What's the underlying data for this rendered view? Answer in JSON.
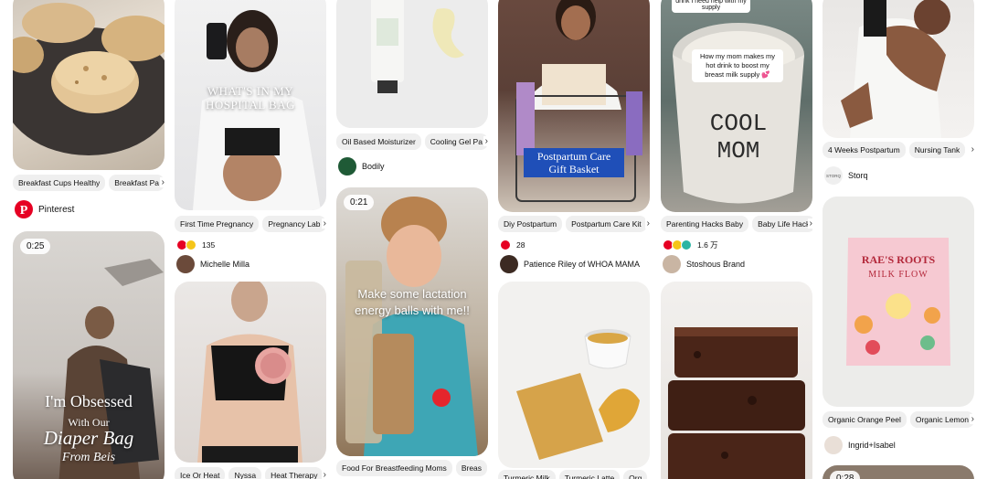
{
  "colors": {
    "pinterest_red": "#e60023",
    "chip_bg": "#efefef"
  },
  "col1": {
    "tags": [
      "Breakfast Cups Healthy",
      "Breakfast Pa"
    ],
    "source_name": "Pinterest",
    "video2_duration": "0:25",
    "video2_line1": "I'm Obsessed",
    "video2_line2": "With Our",
    "video2_line3": "Diaper Bag",
    "video2_line4": "From Beis"
  },
  "col2": {
    "pin1_text": "WHAT'S IN MY HOSPITAL BAG",
    "tags": [
      "First Time Pregnancy",
      "Pregnancy Lab"
    ],
    "reaction_count": "135",
    "author": "Michelle Milla",
    "tags2": [
      "Ice Or Heat",
      "Nyssa",
      "Heat Therapy"
    ]
  },
  "col3": {
    "tags": [
      "Oil Based Moisturizer",
      "Cooling Gel Pa"
    ],
    "author": "Bodily",
    "video_duration": "0:21",
    "video_caption": "Make some lactation energy balls with me!!",
    "tags2": [
      "Food For Breastfeeding Moms",
      "Breas"
    ]
  },
  "col4": {
    "pin1_text": "Postpartum Care Gift Basket",
    "tags": [
      "Diy Postpartum",
      "Postpartum Care Kit"
    ],
    "reaction_count": "28",
    "author": "Patience Riley of WHOA MAMA",
    "tags2": [
      "Turmeric Milk",
      "Turmeric Latte",
      "Org"
    ]
  },
  "col5": {
    "pin1_note_top": "drink I need help with my supply",
    "pin1_note": "How my mom makes my hot drink to boost my breast milk supply 💕",
    "pin1_mug_text": "COOL MOM",
    "tags": [
      "Parenting Hacks Baby",
      "Baby Life Hack"
    ],
    "reaction_count": "1.6 万",
    "author": "Stoshous Brand"
  },
  "col6": {
    "tags": [
      "4 Weeks Postpartum",
      "Nursing Tank"
    ],
    "author": "Storq",
    "author_logo": "STORQ",
    "product_brand": "RAE'S ROOTS",
    "product_name": "MILK FLOW",
    "tags2": [
      "Organic Orange Peel",
      "Organic Lemon"
    ],
    "author2": "Ingrid+Isabel",
    "video_duration": "0:28"
  }
}
